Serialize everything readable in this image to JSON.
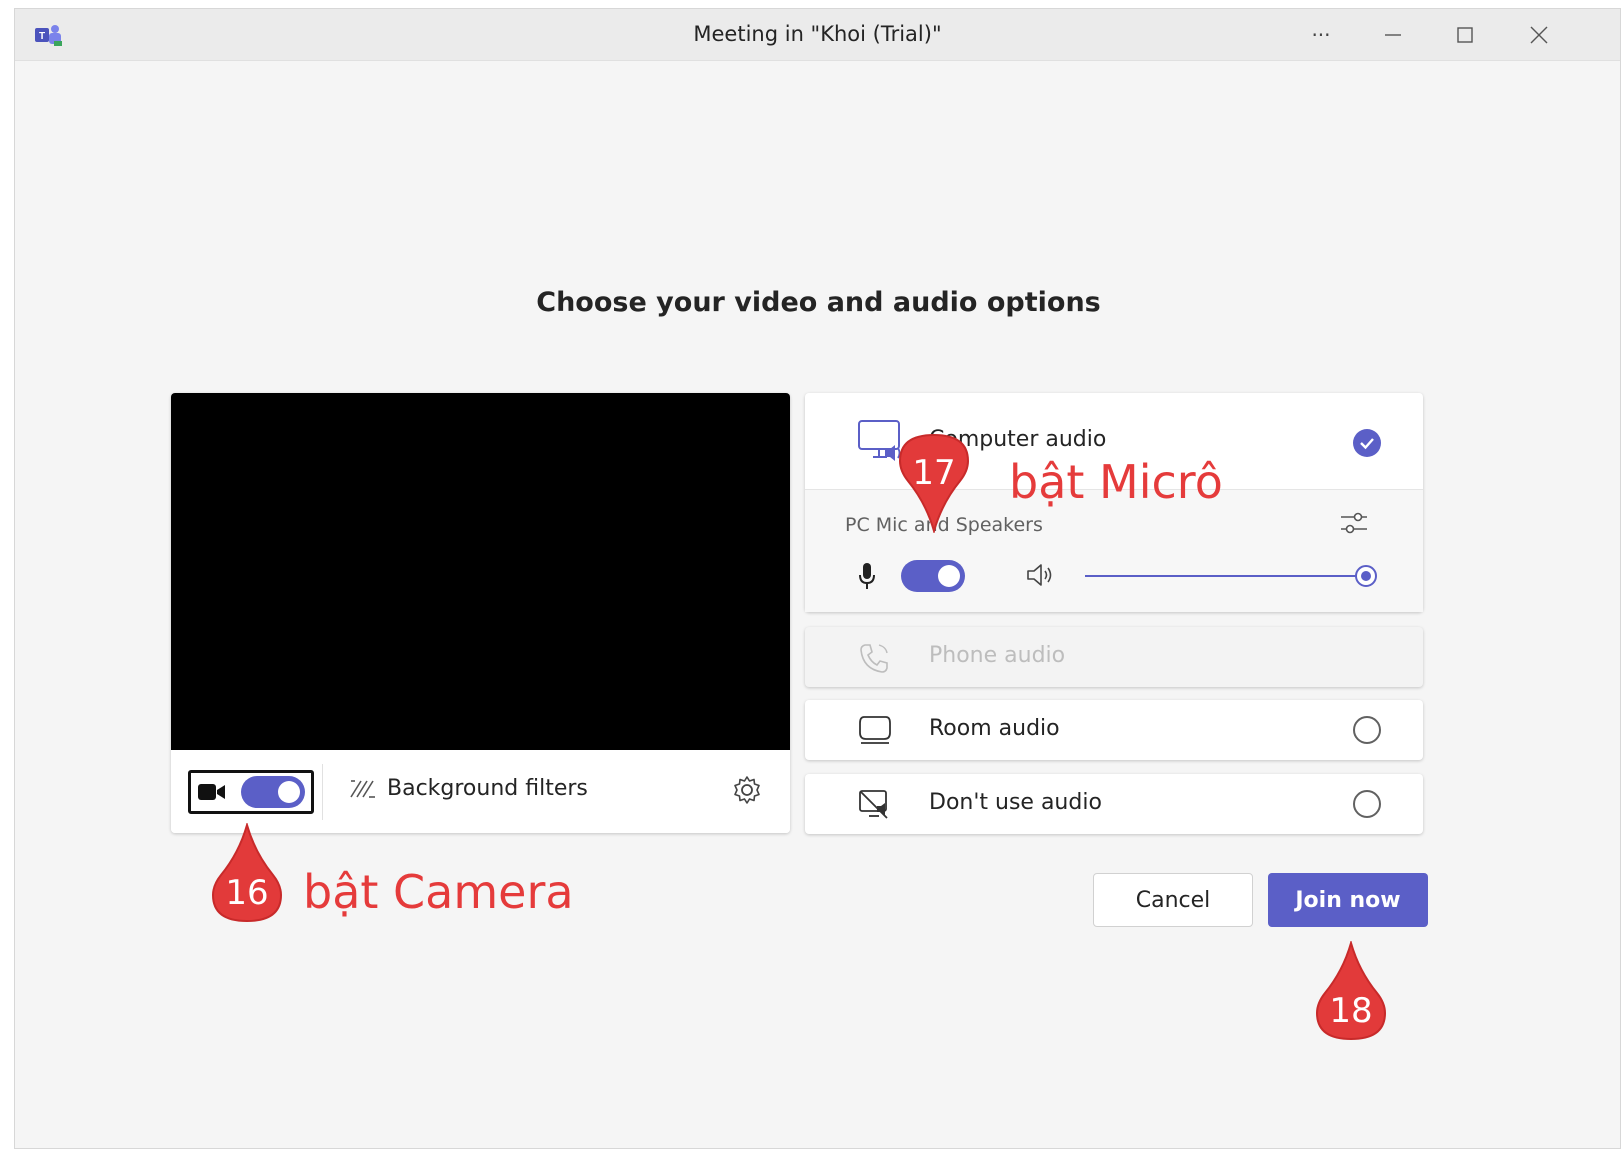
{
  "window": {
    "title": "Meeting in \"Khoi (Trial)\"",
    "controls": [
      "more",
      "minimize",
      "maximize",
      "close"
    ]
  },
  "heading": "Choose your video and audio options",
  "video": {
    "camera_on": true,
    "background_filters_label": "Background filters"
  },
  "audio": {
    "computer_audio": {
      "label": "Computer audio",
      "selected": true,
      "device_label": "PC Mic and Speakers",
      "mic_on": true,
      "volume": 1.0
    },
    "phone_audio": {
      "label": "Phone audio",
      "disabled": true
    },
    "room_audio": {
      "label": "Room audio",
      "selected": false
    },
    "no_audio": {
      "label": "Don't use audio",
      "selected": false
    }
  },
  "actions": {
    "cancel_label": "Cancel",
    "join_label": "Join now"
  },
  "annotations": [
    {
      "number": "16",
      "text": "bật Camera"
    },
    {
      "number": "17",
      "text": "bật Micrô"
    },
    {
      "number": "18",
      "text": ""
    }
  ],
  "colors": {
    "accent": "#5b5fc7",
    "annotation": "#e53b3b",
    "window_bg": "#f5f5f5"
  }
}
